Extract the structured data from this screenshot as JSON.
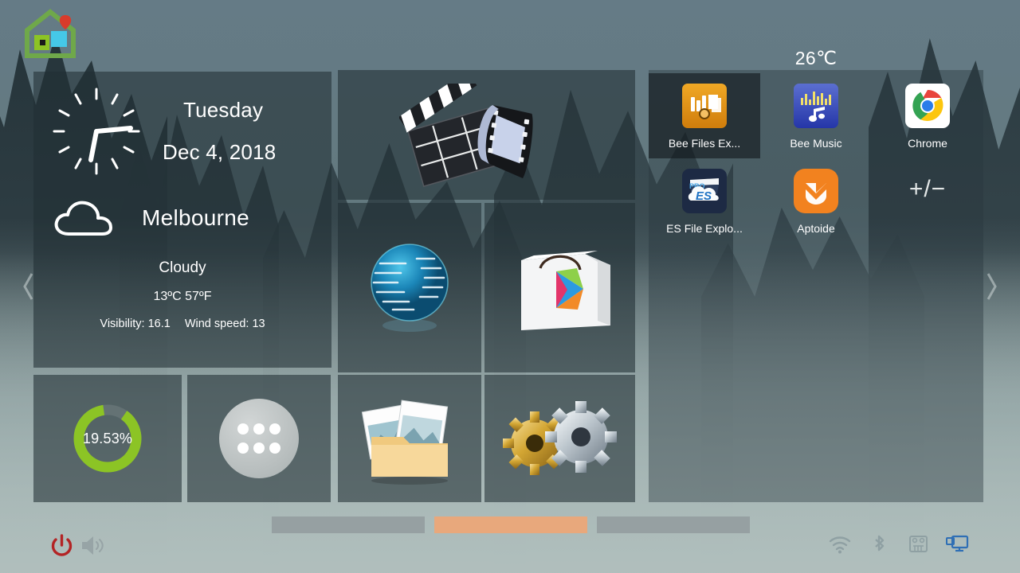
{
  "launcher": {
    "logo_icon": "home-launcher-icon",
    "nav_left_icon": "chevron-left-icon",
    "nav_right_icon": "chevron-right-icon"
  },
  "weather_widget": {
    "clock_icon": "analog-clock-icon",
    "day": "Tuesday",
    "date": "Dec 4, 2018",
    "condition_icon": "cloud-icon",
    "city": "Melbourne",
    "condition": "Cloudy",
    "temperature": "13ºC 57ºF",
    "visibility": "Visibility: 16.1",
    "wind_speed": "Wind speed: 13"
  },
  "battery_widget": {
    "percent_label": "19.53%",
    "percent_value": 19.53,
    "ring_color": "#8cc425",
    "ring_track_color": "rgba(255,255,255,0.10)"
  },
  "app_drawer": {
    "name": "all-apps-button",
    "dot_count": 6
  },
  "tiles": [
    {
      "name": "video-tile",
      "icon": "movie-clapperboard-filmstrip-icon"
    },
    {
      "name": "browser-tile",
      "icon": "globe-browser-icon"
    },
    {
      "name": "store-tile",
      "icon": "play-store-bag-icon"
    },
    {
      "name": "gallery-tile",
      "icon": "gallery-photos-folder-icon"
    },
    {
      "name": "settings-tile",
      "icon": "settings-gears-icon"
    }
  ],
  "apps_panel": {
    "temperature": "26℃",
    "apps": [
      {
        "label": "Bee Files Ex...",
        "icon": "bee-files-explorer-icon",
        "focused": true
      },
      {
        "label": "Bee Music",
        "icon": "bee-music-icon",
        "focused": false
      },
      {
        "label": "Chrome",
        "icon": "chrome-icon",
        "focused": false
      },
      {
        "label": "ES File Explo...",
        "icon": "es-file-explorer-icon",
        "focused": false
      },
      {
        "label": "Aptoide",
        "icon": "aptoide-icon",
        "focused": false
      }
    ],
    "add_remove_label": "+/−"
  },
  "pager": {
    "pages": [
      {
        "active": false
      },
      {
        "active": true
      },
      {
        "active": false
      }
    ],
    "active_color": "#e8a87c",
    "inactive_color": "#96a0a2"
  },
  "system_controls": {
    "power_icon": "power-icon",
    "power_color": "#b32425",
    "volume_icon": "volume-icon"
  },
  "status_icons": [
    {
      "name": "wifi-icon",
      "active": false
    },
    {
      "name": "bluetooth-icon",
      "active": false
    },
    {
      "name": "sd-card-icon",
      "active": false
    },
    {
      "name": "display-icon",
      "active": true,
      "color": "#2f6fb5"
    }
  ]
}
